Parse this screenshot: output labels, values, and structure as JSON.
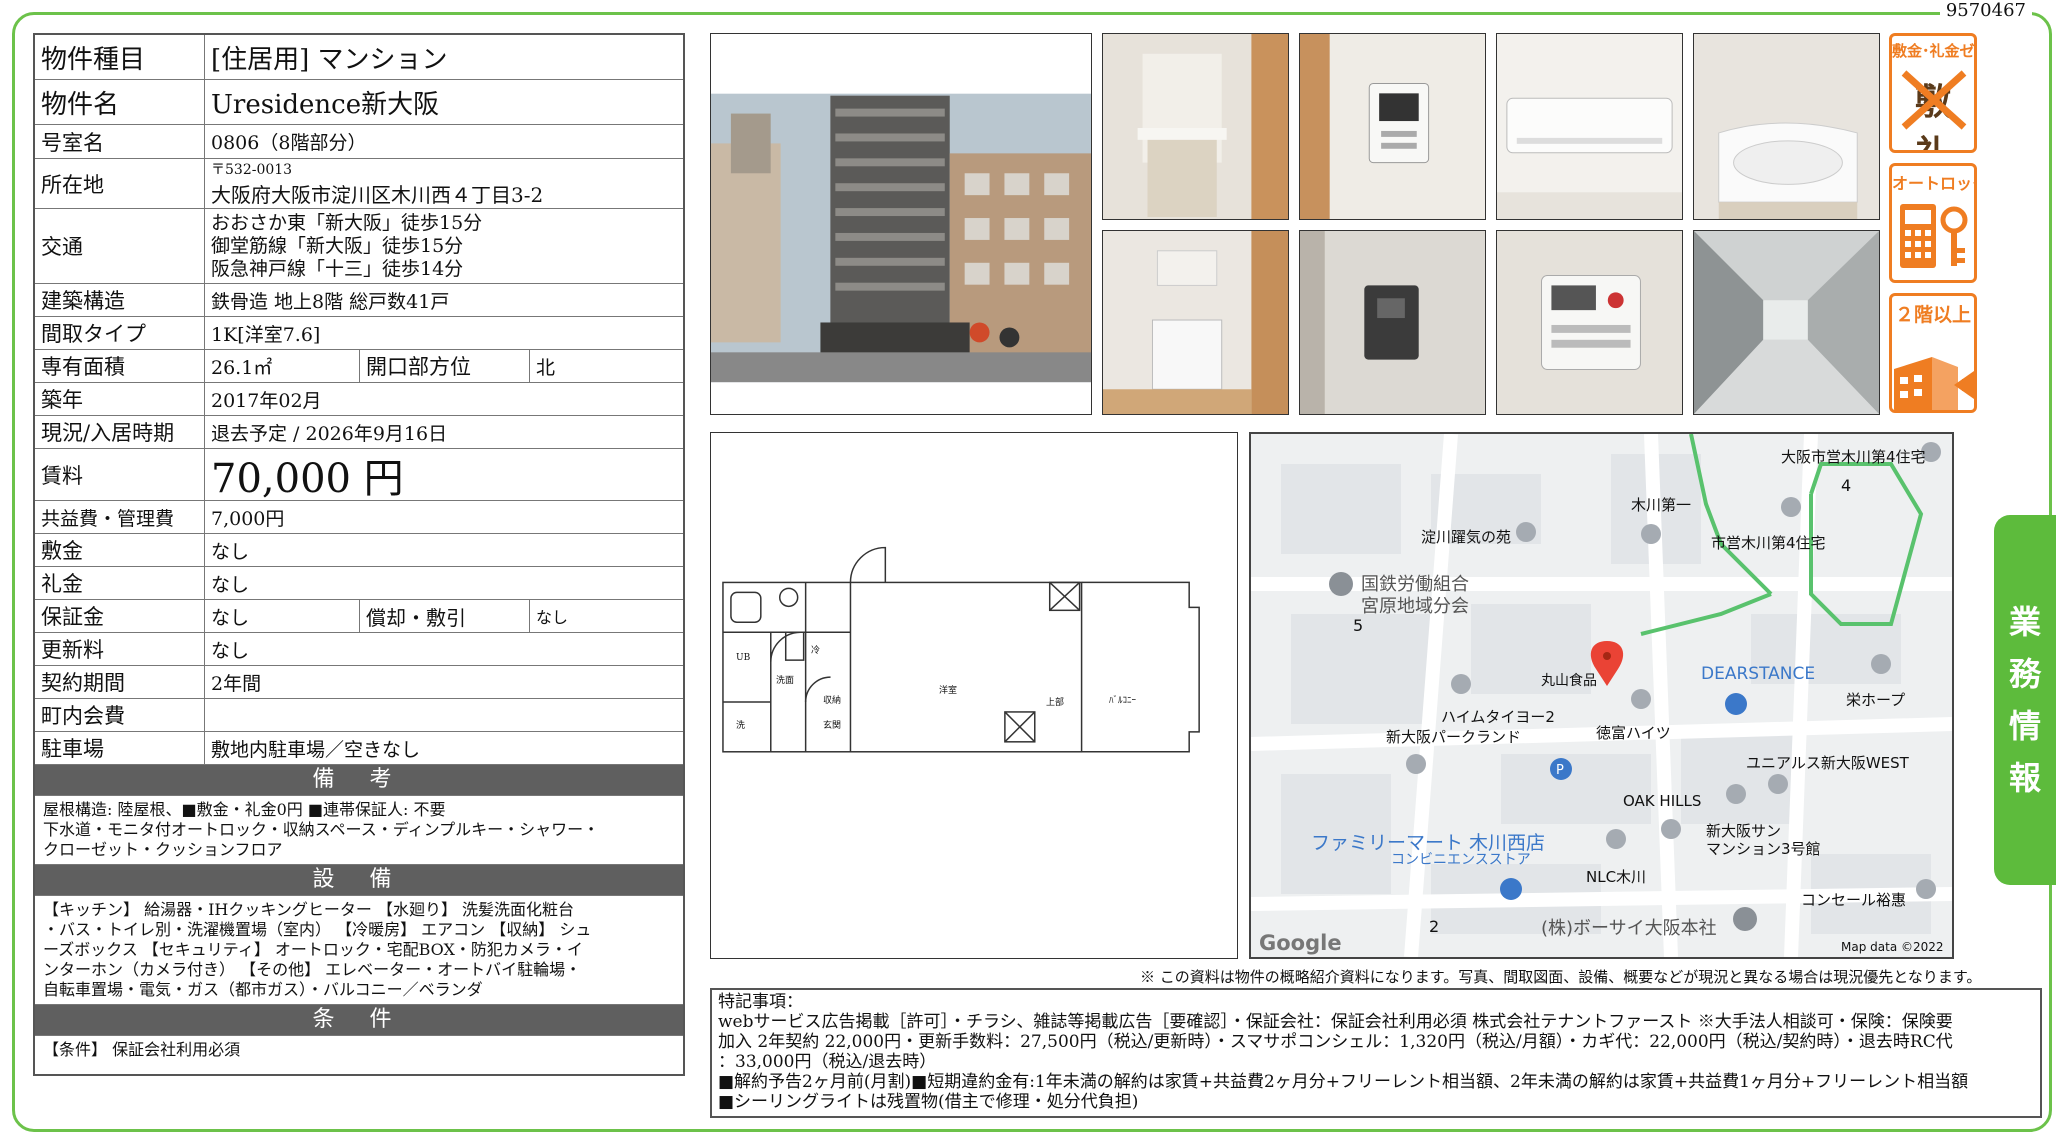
{
  "doc_id": "9570467",
  "property": {
    "type_label": "物件種目",
    "type_value": "[住居用] マンション",
    "name_label": "物件名",
    "name_value": "Uresidence新大阪",
    "room_label": "号室名",
    "room_value": "0806（8階部分）",
    "address_label": "所在地",
    "postal": "〒532-0013",
    "address": "大阪府大阪市淀川区木川西４丁目3-2",
    "transport_label": "交通",
    "transport": [
      "おおさか東「新大阪」徒歩15分",
      "御堂筋線「新大阪」徒歩15分",
      "阪急神戸線「十三」徒歩14分"
    ],
    "structure_label": "建築構造",
    "structure_value": "鉄骨造 地上8階 総戸数41戸",
    "layout_label": "間取タイプ",
    "layout_value": "1K[洋室7.6]",
    "area_label": "専有面積",
    "area_value": "26.1㎡",
    "opening_label": "開口部方位",
    "opening_value": "北",
    "built_label": "築年",
    "built_value": "2017年02月",
    "status_label": "現況/入居時期",
    "status_value": "退去予定 / 2026年9月16日",
    "rent_label": "賃料",
    "rent_value": "70,000 円",
    "fee_label": "共益費・管理費",
    "fee_value": "7,000円",
    "deposit_label": "敷金",
    "deposit_value": "なし",
    "key_money_label": "礼金",
    "key_money_value": "なし",
    "guarantee_label": "保証金",
    "guarantee_value": "なし",
    "amort_label": "償却・敷引",
    "amort_value": "なし",
    "renewal_label": "更新料",
    "renewal_value": "なし",
    "contract_label": "契約期間",
    "contract_value": "2年間",
    "town_label": "町内会費",
    "town_value": "",
    "parking_label": "駐車場",
    "parking_value": "敷地内駐車場／空きなし"
  },
  "remarks": {
    "title": "備 考",
    "lines": [
      "屋根構造: 陸屋根、■敷金・礼金0円 ■連帯保証人: 不要",
      "下水道・モニタ付オートロック・収納スペース・ディンプルキー・シャワー・",
      "クローゼット・クッションフロア"
    ]
  },
  "equipment": {
    "title": "設 備",
    "lines": [
      "【キッチン】 給湯器・IHクッキングヒーター 【水廻り】 洗髪洗面化粧台",
      "・バス・トイレ別・洗濯機置場（室内） 【冷暖房】 エアコン 【収納】 シュ",
      "ーズボックス 【セキュリティ】 オートロック・宅配BOX・防犯カメラ・イ",
      "ンターホン（カメラ付き） 【その他】 エレベーター・オートバイ駐輪場・",
      "自転車置場・電気・ガス（都市ガス）・バルコニー／ベランダ"
    ]
  },
  "conditions": {
    "title": "条 件",
    "lines": [
      "【条件】 保証会社利用必須"
    ]
  },
  "badges": [
    {
      "title": "敷金･礼金ゼロ",
      "art": "敷 礼"
    },
    {
      "title": "オートロック"
    },
    {
      "title": "２階以上"
    }
  ],
  "side_tab": [
    "業",
    "務",
    "情",
    "報"
  ],
  "disclaimer": "※ この資料は物件の概略紹介資料になります。写真、間取図面、設備、概要などが現況と異なる場合は現況優先となります。",
  "special": {
    "lines": [
      "特記事項：",
      "webサービス広告掲載［許可］・チラシ、雑誌等掲載広告［要確認］・保証会社：保証会社利用必須 株式会社テナントファースト ※大手法人相談可・保険：保険要",
      "加入 2年契約 22,000円・更新手数料：27,500円（税込/更新時）・スマサポコンシェル：1,320円（税込/月額）・カギ代：22,000円（税込/契約時）・退去時RC代",
      "：33,000円（税込/退去時）",
      "■解約予告2ヶ月前(月割)■短期違約金有:1年未満の解約は家賃+共益費2ヶ月分+フリーレント相当額、2年未満の解約は家賃+共益費1ヶ月分+フリーレント相当額",
      "■シーリングライトは残置物(借主で修理・処分代負担)"
    ]
  },
  "floorplan": {
    "labels": [
      "洋室",
      "玄関",
      "UB",
      "洗面",
      "冷",
      "洗",
      "収納",
      "上部",
      "ﾊﾞﾙｺﾆｰ"
    ]
  },
  "map": {
    "labels": [
      {
        "t": "大阪市営木川第4住宅",
        "c": "#333"
      },
      {
        "t": "木川第一",
        "c": "#333"
      },
      {
        "t": "淀川躍気の苑",
        "c": "#333"
      },
      {
        "t": "市営木川第4住宅",
        "c": "#333"
      },
      {
        "t": "国鉄労働組合",
        "c": "#555"
      },
      {
        "t": "宮原地域分会",
        "c": "#555"
      },
      {
        "t": "5",
        "c": "#333"
      },
      {
        "t": "4",
        "c": "#333"
      },
      {
        "t": "丸山食品",
        "c": "#333"
      },
      {
        "t": "DEARSTANCE",
        "c": "#3b78c9"
      },
      {
        "t": "栄ホープ",
        "c": "#333"
      },
      {
        "t": "ハイムタイヨー2",
        "c": "#333"
      },
      {
        "t": "徳富ハイツ",
        "c": "#333"
      },
      {
        "t": "新大阪パークランド",
        "c": "#333"
      },
      {
        "t": "ユニアルス新大阪WEST",
        "c": "#333"
      },
      {
        "t": "OAK HILLS",
        "c": "#333"
      },
      {
        "t": "新大阪サン",
        "c": "#333"
      },
      {
        "t": "マンション3号館",
        "c": "#333"
      },
      {
        "t": "ファミリーマート 木川西店",
        "c": "#3b78c9"
      },
      {
        "t": "コンビニエンスストア",
        "c": "#3b78c9"
      },
      {
        "t": "NLC木川",
        "c": "#333"
      },
      {
        "t": "コンセール裕惠",
        "c": "#333"
      },
      {
        "t": "2",
        "c": "#333"
      },
      {
        "t": "(株)ボーサイ大阪本社",
        "c": "#555"
      },
      {
        "t": "Google",
        "c": "#777"
      },
      {
        "t": "Map data ©2022",
        "c": "#333"
      }
    ]
  },
  "colors": {
    "frame": "#6cc24a",
    "badge": "#ef7d22",
    "tab": "#5dbb3c",
    "section": "#5f5f5f",
    "pin": "#ea4335"
  }
}
